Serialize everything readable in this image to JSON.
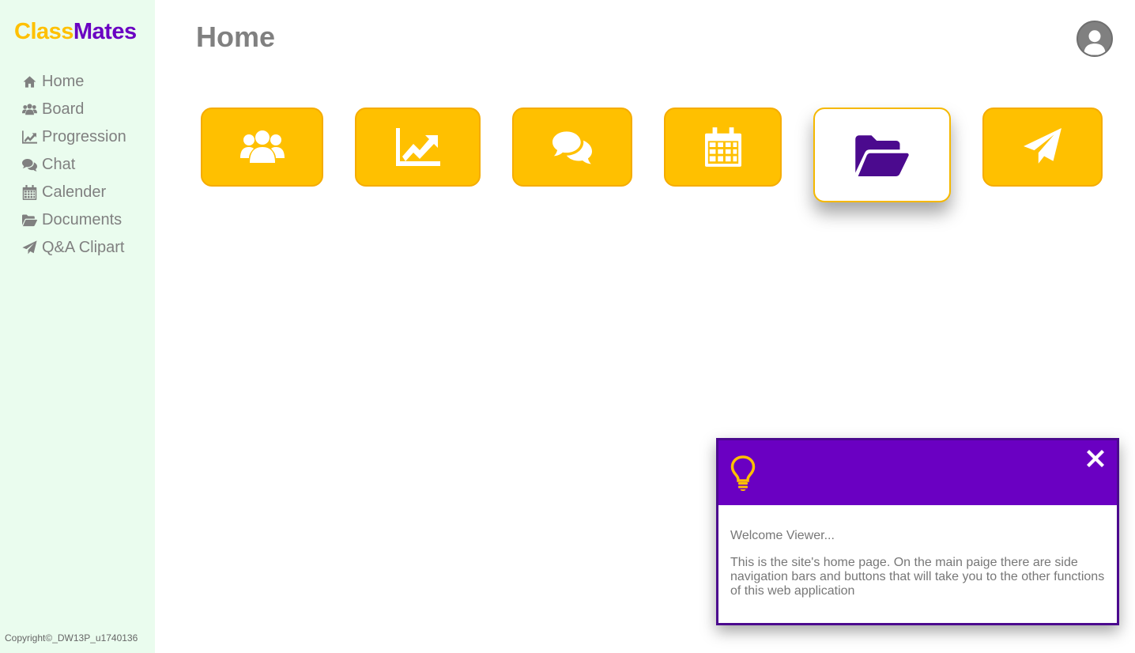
{
  "app": {
    "logo_part1": "Class",
    "logo_part2": "Mates",
    "brand_color": "#ffc000",
    "accent_color": "#6a00c2"
  },
  "sidebar": {
    "items": [
      {
        "label": "Home",
        "icon": "home-icon"
      },
      {
        "label": "Board",
        "icon": "users-icon"
      },
      {
        "label": "Progression",
        "icon": "chart-line-icon"
      },
      {
        "label": "Chat",
        "icon": "comments-icon"
      },
      {
        "label": "Calender",
        "icon": "calendar-icon"
      },
      {
        "label": "Documents",
        "icon": "folder-open-icon"
      },
      {
        "label": "Q&A Clipart",
        "icon": "paper-plane-icon"
      }
    ],
    "copyright": "Copyright©_DW13P_u1740136"
  },
  "header": {
    "title": "Home",
    "avatar_icon": "user-icon"
  },
  "tiles": [
    {
      "icon": "users-icon",
      "active": false
    },
    {
      "icon": "chart-line-icon",
      "active": false
    },
    {
      "icon": "comments-icon",
      "active": false
    },
    {
      "icon": "calendar-icon",
      "active": false
    },
    {
      "icon": "folder-open-icon",
      "active": true
    },
    {
      "icon": "paper-plane-icon",
      "active": false
    }
  ],
  "popup": {
    "header_icon": "lightbulb-icon",
    "close_icon": "close-icon",
    "greeting": "Welcome Viewer...",
    "message": "This is the site's home page. On the main paige there are side navigation bars and buttons that will take you to the other functions of this web application"
  }
}
